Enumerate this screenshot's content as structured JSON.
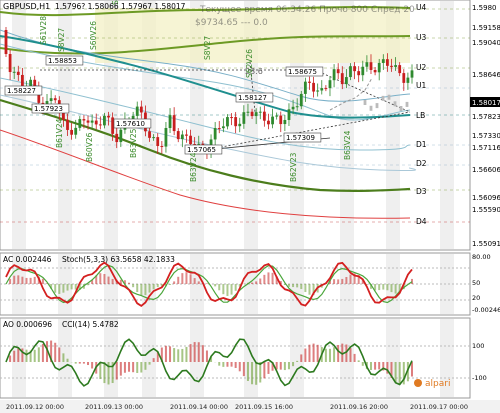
{
  "header": {
    "symbol": "GBPUSD,H1",
    "ohlc": "1.5796? 1.58066 1.57967 1.58017",
    "overlay_line1": "Текущее время 06:34:26 Прочо 800 Спред 20",
    "overlay_line2": "$9734.65 --- 0.0"
  },
  "price_scale": [
    "1.5980",
    "1.59158",
    "1.59040",
    "1.58646",
    "1.58017",
    "1.57823",
    "1.57330",
    "1.57116",
    "1.56606",
    "1.56096",
    "1.55590",
    "1.55091"
  ],
  "level_labels": [
    "U4",
    "U3",
    "U2",
    "U1",
    "LB",
    "D1",
    "D2",
    "D3",
    "D4"
  ],
  "price_annotations": [
    "1.58227",
    "1.57923",
    "1.58853",
    "1.57610",
    "1.57065",
    "1.58127",
    "1.57309",
    "1.58675",
    "23.6"
  ],
  "wave_labels": [
    "S61V28",
    "S8V27",
    "S60V26",
    "S61V25",
    "B61V24",
    "B60V26",
    "B63V25",
    "B63V24",
    "S8V27",
    "S62V26",
    "B62V23",
    "B63V24"
  ],
  "ac_panel": {
    "label": "AC 0.002446",
    "stoch_label": "Stoch(5,3,3) 63.5658 42.1833",
    "scale": [
      "80.00",
      "50",
      "20",
      "-0.00246"
    ]
  },
  "ao_panel": {
    "label": "AO 0.000696",
    "cci_label": "CCI(14) 5.4782",
    "scale": [
      "100",
      "-100"
    ]
  },
  "time_axis": [
    "2011.09.12 00:00",
    "2011.09.13 00:00",
    "2011.09.14 00:00",
    "2011.09.15 16:00",
    "2011.09.16 20:00",
    "2011.09.17 00:00"
  ],
  "brand": "alpari",
  "colors": {
    "bull": "#2f8a2f",
    "bear": "#c81e1e",
    "ma_green": "#4c7d1c",
    "ma_teal": "#1f8f8f",
    "ma_red": "#e04040",
    "stoch_red": "#d42020",
    "stoch_green": "#4aa63b"
  }
}
